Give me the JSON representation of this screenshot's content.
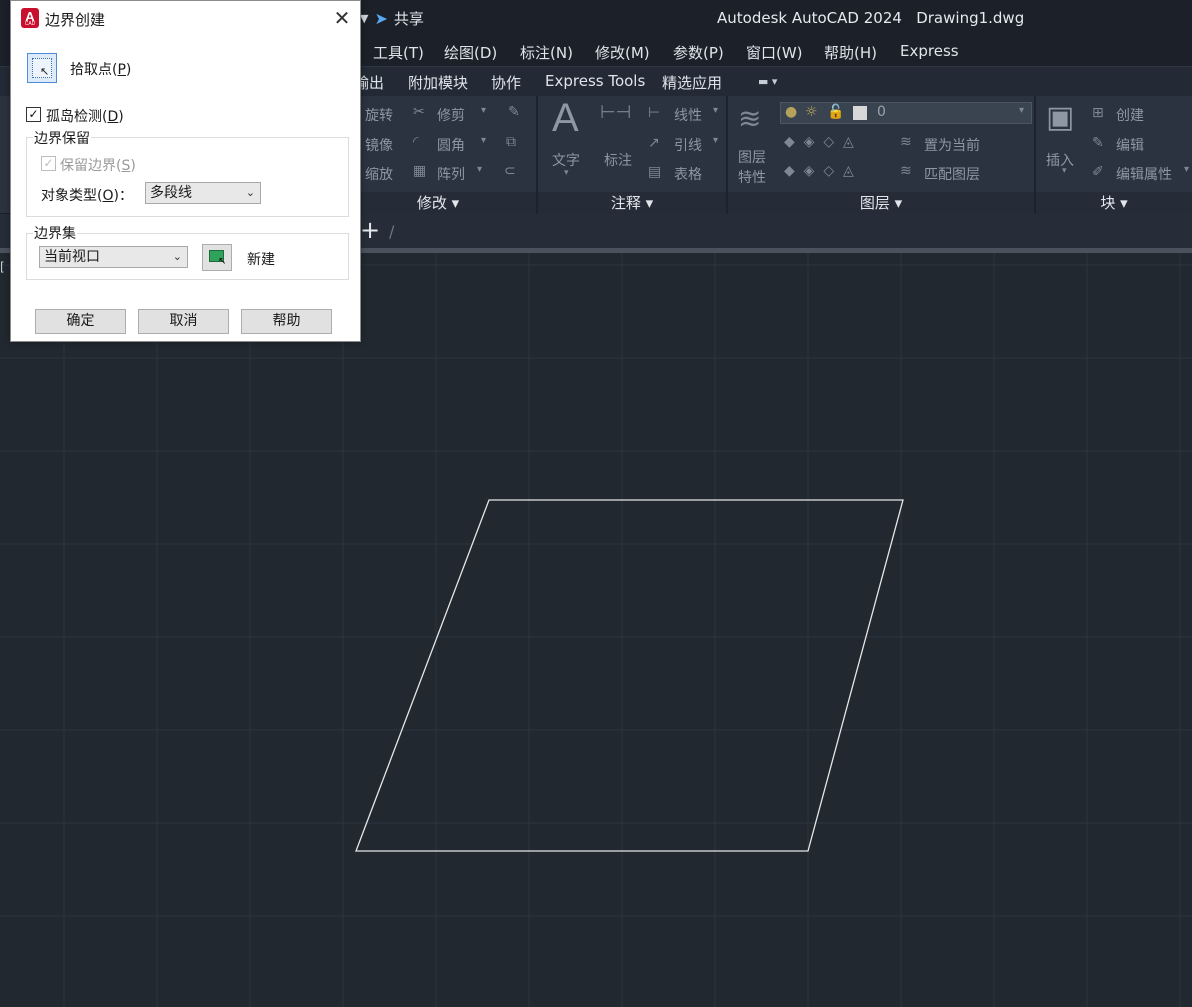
{
  "titlebar": {
    "share_label": "共享",
    "app_title": "Autodesk AutoCAD 2024",
    "doc_title": "Drawing1.dwg"
  },
  "menubar": [
    "工具(T)",
    "绘图(D)",
    "标注(N)",
    "修改(M)",
    "参数(P)",
    "窗口(W)",
    "帮助(H)",
    "Express"
  ],
  "ribbon_tabs": [
    "输出",
    "附加模块",
    "协作",
    "Express Tools",
    "精选应用"
  ],
  "ribbon": {
    "modify": {
      "title": "修改",
      "items": [
        "旋转",
        "修剪",
        "镜像",
        "圆角",
        "缩放",
        "阵列"
      ]
    },
    "annotation": {
      "title": "注释",
      "text": "文字",
      "dimension": "标注",
      "items": [
        "线性",
        "引线",
        "表格"
      ]
    },
    "layers": {
      "title": "图层",
      "props": "图层\n特性",
      "current_layer": "0",
      "set_current": "置为当前",
      "match": "匹配图层"
    },
    "block": {
      "title": "块",
      "insert": "插入",
      "items": [
        "创建",
        "编辑",
        "编辑属性"
      ]
    }
  },
  "dialog": {
    "title": "边界创建",
    "pick_points": {
      "text": "拾取点(",
      "key": "P",
      "close": ")"
    },
    "island_detect": {
      "text": "孤岛检测(",
      "key": "D",
      "close": ")",
      "checked": true
    },
    "boundary_retention": {
      "legend": "边界保留",
      "retain": {
        "text": "保留边界(",
        "key": "S",
        "close": ")",
        "checked": true,
        "disabled": true
      },
      "object_type_label": {
        "text": "对象类型(",
        "key": "O",
        "close": ")："
      },
      "object_type_value": "多段线"
    },
    "boundary_set": {
      "legend": "边界集",
      "value": "当前视口",
      "new_label": "新建"
    },
    "buttons": {
      "ok": "确定",
      "cancel": "取消",
      "help": "帮助"
    }
  },
  "canvas": {
    "background": "#212830",
    "shape": "parallelogram",
    "shape_color": "#e6e6e6"
  }
}
